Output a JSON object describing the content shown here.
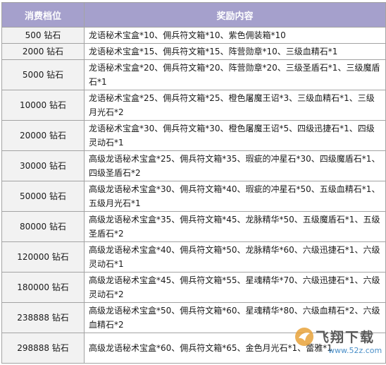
{
  "table": {
    "headers": [
      "消费档位",
      "奖励内容"
    ],
    "rows": [
      {
        "tier": "500 钻石",
        "reward": "龙语秘术宝盒*10、佣兵符文箱*10、紫色佣装箱*10"
      },
      {
        "tier": "2000 钻石",
        "reward": "龙语秘术宝盒*15、佣兵符文箱*15、阵营勋章*10、三级血精石*1"
      },
      {
        "tier": "5000 钻石",
        "reward": "龙语秘术宝盒*20、佣兵符文箱*20、阵营勋章*20、三级圣盾石*1、三级魔盾石*1"
      },
      {
        "tier": "10000 钻石",
        "reward": "龙语秘术宝盒*25、佣兵符文箱*25、橙色屠魔王诏*3、三级血精石*1、三级月光石*2"
      },
      {
        "tier": "20000 钻石",
        "reward": "龙语秘术宝盒*30、佣兵符文箱*30、橙色屠魔王诏*5、四级迅捷石*1、四级灵动石*1"
      },
      {
        "tier": "30000 钻石",
        "reward": "高级龙语秘术宝盒*25、佣兵符文箱*35、瑕疵的冲星石*30、四级魔盾石*1、四级圣盾石*2"
      },
      {
        "tier": "50000 钻石",
        "reward": "高级龙语秘术宝盒*30、佣兵符文箱*40、瑕疵的冲星石*50、五级血精石*1、五级月光石*1"
      },
      {
        "tier": "80000 钻石",
        "reward": "高级龙语秘术宝盒*35、佣兵符文箱*45、龙脉精华*50、五级魔盾石*1、五级圣盾石*2"
      },
      {
        "tier": "120000 钻石",
        "reward": "高级龙语秘术宝盒*40、佣兵符文箱*50、龙脉精华*60、六级迅捷石*1、六级灵动石*1"
      },
      {
        "tier": "180000 钻石",
        "reward": "高级龙语秘术宝盒*45、佣兵符文箱*55、星魂精华*70、六级迅捷石*1、六级灵动石*2"
      },
      {
        "tier": "238888 钻石",
        "reward": "高级龙语秘术宝盒*50、佣兵符文箱*60、星魂精华*80、六级血精石*2、六级血精石*2"
      },
      {
        "tier": "298888 钻石",
        "reward": "高级龙语秘术宝盒*60、佣兵符文箱*65、金色月光石*1、蕾雅*1"
      }
    ]
  },
  "watermark": {
    "title": "飞翔下载",
    "url": "www.52z.com",
    "logo_color": "#e8a23a"
  }
}
